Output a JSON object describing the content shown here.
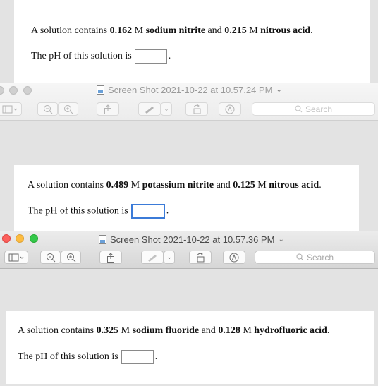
{
  "panels": [
    {
      "intro": "A solution contains ",
      "c1": "0.162",
      "unit": " M ",
      "s1": "sodium nitrite",
      "and": " and ",
      "c2": "0.215",
      "s2": "nitrous acid",
      "end": ".",
      "ph_prompt": "The pH of this solution is",
      "answer": ""
    },
    {
      "intro": "A solution contains ",
      "c1": "0.489",
      "unit": " M ",
      "s1": "potassium nitrite",
      "and": " and ",
      "c2": "0.125",
      "s2": "nitrous acid",
      "end": ".",
      "ph_prompt": "The pH of this solution is",
      "answer": ""
    },
    {
      "intro": "A solution contains ",
      "c1": "0.325",
      "unit": " M ",
      "s1": "sodium fluoride",
      "and": " and ",
      "c2": "0.128",
      "s2": "hydrofluoric acid",
      "end": ".",
      "ph_prompt": "The pH of this solution is",
      "answer": ""
    }
  ],
  "windows": [
    {
      "title": "Screen Shot 2021-10-22 at 10.57.24 PM",
      "search_placeholder": "Search"
    },
    {
      "title": "Screen Shot 2021-10-22 at 10.57.36 PM",
      "search_placeholder": "Search"
    }
  ],
  "period": "."
}
